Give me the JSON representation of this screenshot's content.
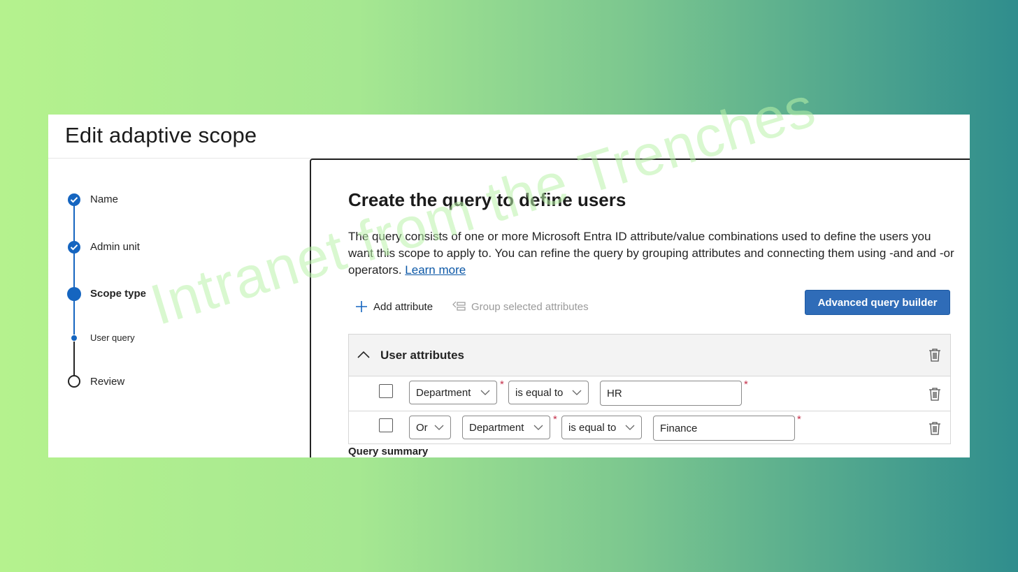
{
  "page": {
    "title": "Edit adaptive scope"
  },
  "stepper": {
    "steps": [
      {
        "label": "Name",
        "state": "completed"
      },
      {
        "label": "Admin unit",
        "state": "completed"
      },
      {
        "label": "Scope type",
        "state": "current"
      },
      {
        "label": "User query",
        "state": "current-substep"
      },
      {
        "label": "Review",
        "state": "not-started"
      }
    ]
  },
  "main": {
    "title": "Create the query to define users",
    "description": "The query consists of one or more Microsoft Entra ID attribute/value combinations used to define the users you want this scope to apply to. You can refine the query by grouping attributes and connecting them using -and and -or operators.",
    "learn_more": "Learn more",
    "toolbar": {
      "add_attribute": "Add attribute",
      "group_selected": "Group selected attributes",
      "advanced_builder": "Advanced query builder"
    },
    "attributes": {
      "header": "User attributes",
      "rows": [
        {
          "attribute": "Department",
          "operator": "is equal to",
          "value": "HR"
        },
        {
          "connector": "Or",
          "attribute": "Department",
          "operator": "is equal to",
          "value": "Finance"
        }
      ]
    },
    "query_summary": "Query summary"
  },
  "colors": {
    "accent": "#1565c0",
    "primary_button": "#2f6cb8",
    "required": "#c4314b"
  },
  "icons": [
    "check-icon",
    "plus-icon",
    "group-icon",
    "chevron-up-icon",
    "chevron-down-icon",
    "trash-icon"
  ],
  "watermark": "Intranet from the Trenches"
}
